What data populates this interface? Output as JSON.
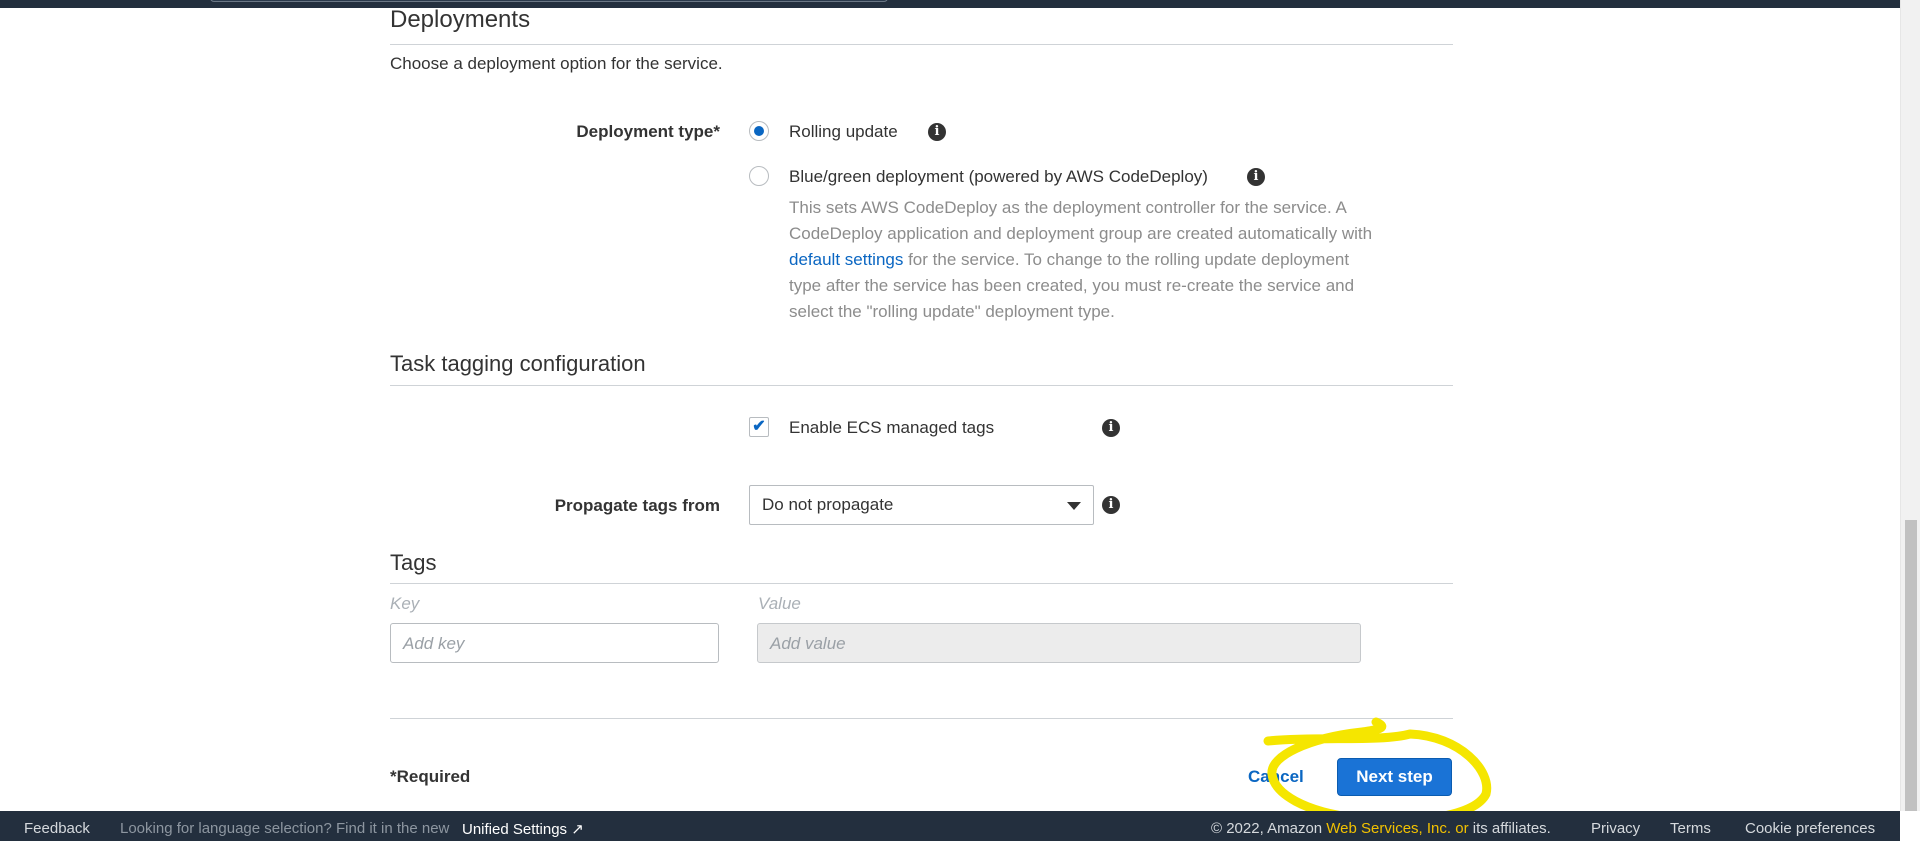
{
  "deployments": {
    "title": "Deployments",
    "description": "Choose a deployment option for the service.",
    "type_label": "Deployment type*",
    "options": [
      {
        "label": "Rolling update",
        "checked": true
      },
      {
        "label": "Blue/green deployment (powered by AWS CodeDeploy)",
        "checked": false
      }
    ],
    "help_before": "This sets AWS CodeDeploy as the deployment controller for the service. A CodeDeploy application and deployment group are created automatically with ",
    "help_link": "default settings",
    "help_after": " for the service. To change to the rolling update deployment type after the service has been created, you must re-create the service and select the \"rolling update\" deployment type."
  },
  "task_tagging": {
    "title": "Task tagging configuration",
    "ecs_tags_label": "Enable ECS managed tags",
    "ecs_tags_checked": true,
    "propagate_label": "Propagate tags from",
    "propagate_value": "Do not propagate"
  },
  "tags": {
    "title": "Tags",
    "key_label": "Key",
    "value_label": "Value",
    "key_placeholder": "Add key",
    "value_placeholder": "Add value"
  },
  "actions": {
    "required": "*Required",
    "cancel": "Cancel",
    "next": "Next step"
  },
  "footer": {
    "feedback": "Feedback",
    "language_note": "Looking for language selection? Find it in the new",
    "unified_settings": "Unified Settings",
    "copyright_pre": "© 2022, Amazon",
    "copyright_link": "Web Services, Inc. or",
    "copyright_post": "its affiliates.",
    "privacy": "Privacy",
    "terms": "Terms",
    "cookie": "Cookie preferences"
  },
  "colors": {
    "accent": "#0a66c2",
    "primary_button": "#1a73d6",
    "highlight": "#f5e600",
    "footer_bg": "#232f3e"
  }
}
